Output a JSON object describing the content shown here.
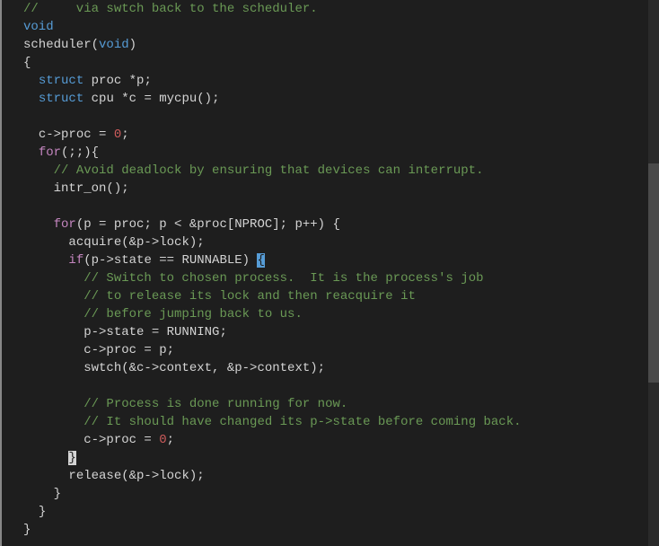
{
  "code": {
    "l1_comment": "//     via swtch back to the scheduler.",
    "l2_void": "void",
    "l3_func": "scheduler",
    "l3_paren_open": "(",
    "l3_void": "void",
    "l3_paren_close": ")",
    "l4_brace": "{",
    "l5_struct": "struct",
    "l5_type": " proc ",
    "l5_rest": "*p;",
    "l6_struct": "struct",
    "l6_type": " cpu ",
    "l6_rest": "*c = mycpu();",
    "l8_a": "c->proc = ",
    "l8_zero": "0",
    "l8_semi": ";",
    "l9_for": "for",
    "l9_rest": "(;;){",
    "l10_comment": "// Avoid deadlock by ensuring that devices can interrupt.",
    "l11": "intr_on();",
    "l13_for": "for",
    "l13_a": "(p = proc; p < &proc[NPROC]; p++) {",
    "l14": "acquire(&p->lock);",
    "l15_if": "if",
    "l15_cond": "(p->state == RUNNABLE) ",
    "l15_brace": "{",
    "l16_comment": "// Switch to chosen process.  It is the process's job",
    "l17_comment": "// to release its lock and then reacquire it",
    "l18_comment": "// before jumping back to us.",
    "l19": "p->state = RUNNING;",
    "l20": "c->proc = p;",
    "l21": "swtch(&c->context, &p->context);",
    "l23_comment": "// Process is done running for now.",
    "l24_comment": "// It should have changed its p->state before coming back.",
    "l25_a": "c->proc = ",
    "l25_zero": "0",
    "l25_semi": ";",
    "l26_brace": "}",
    "l27": "release(&p->lock);",
    "l28": "}",
    "l29": "}",
    "l30": "}"
  }
}
